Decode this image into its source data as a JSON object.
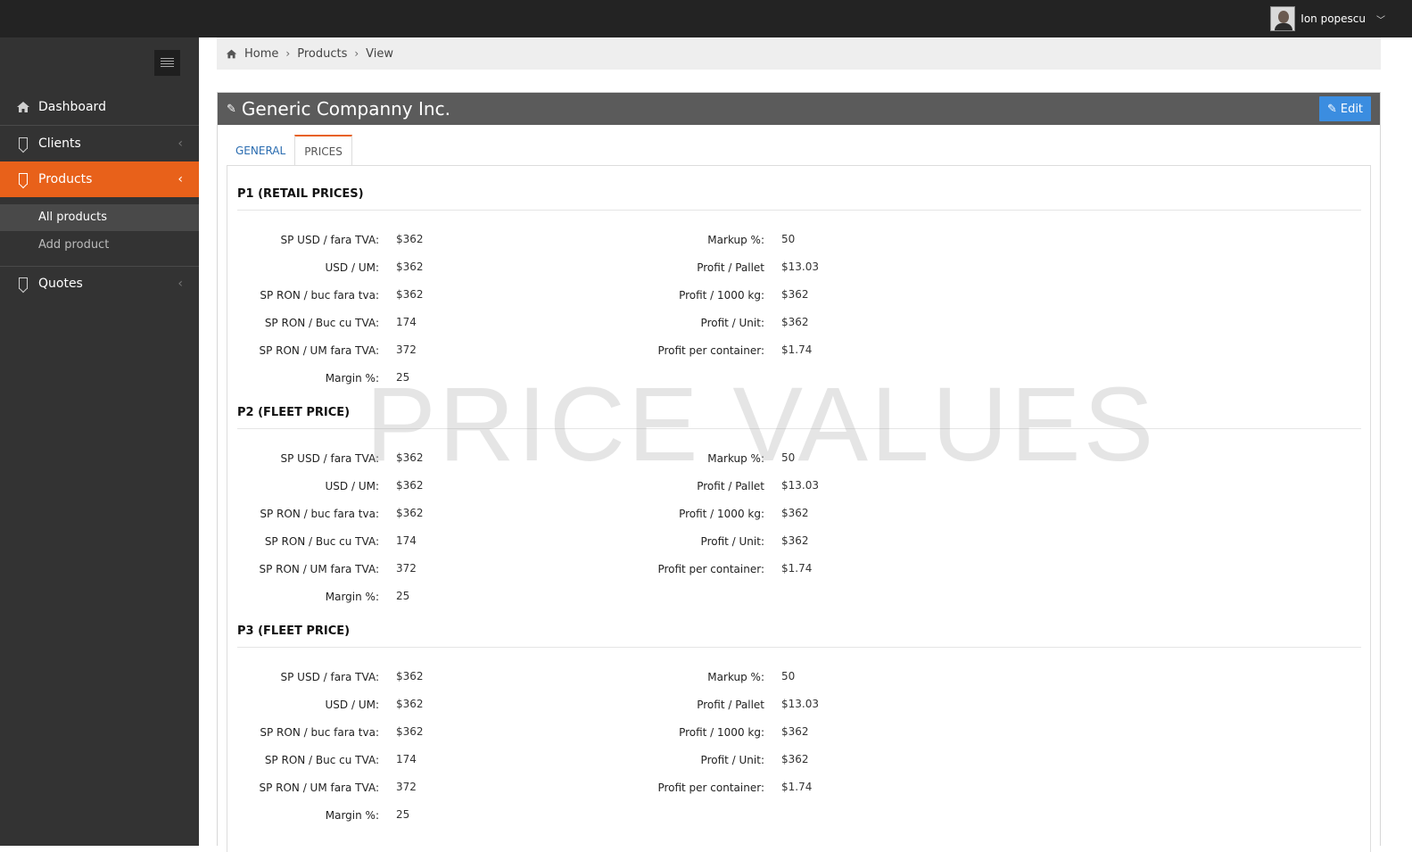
{
  "topbar": {
    "user_name": "Ion popescu",
    "caret": "﹀"
  },
  "sidebar": {
    "items": [
      {
        "label": "Dashboard",
        "chevron": ""
      },
      {
        "label": "Clients",
        "chevron": "‹"
      },
      {
        "label": "Products",
        "chevron": "‹"
      },
      {
        "label": "Quotes",
        "chevron": "‹"
      }
    ],
    "subitems": [
      {
        "label": "All products"
      },
      {
        "label": "Add product"
      }
    ]
  },
  "breadcrumb": {
    "home": "Home",
    "products": "Products",
    "view": "View",
    "sep": "›"
  },
  "panel": {
    "title": "Generic Companny Inc.",
    "edit_label": "Edit",
    "pencil": "✎"
  },
  "tabs": [
    {
      "label": "GENERAL"
    },
    {
      "label": "PRICES"
    }
  ],
  "sections": [
    {
      "title": "P1 (RETAIL PRICES)",
      "left": [
        {
          "label": "SP USD / fara TVA:",
          "value": "$362"
        },
        {
          "label": "USD / UM:",
          "value": "$362"
        },
        {
          "label": "SP RON / buc fara tva:",
          "value": "$362"
        },
        {
          "label": "SP RON / Buc cu TVA:",
          "value": "174"
        },
        {
          "label": "SP RON / UM fara TVA:",
          "value": "372"
        },
        {
          "label": "Margin %:",
          "value": "25"
        }
      ],
      "right": [
        {
          "label": "Markup %:",
          "value": "50"
        },
        {
          "label": "Profit / Pallet",
          "value": "$13.03"
        },
        {
          "label": "Profit / 1000 kg:",
          "value": "$362"
        },
        {
          "label": "Profit / Unit:",
          "value": "$362"
        },
        {
          "label": "Profit per container:",
          "value": "$1.74"
        }
      ]
    },
    {
      "title": "P2 (FLEET PRICE)",
      "left": [
        {
          "label": "SP USD / fara TVA:",
          "value": "$362"
        },
        {
          "label": "USD / UM:",
          "value": "$362"
        },
        {
          "label": "SP RON / buc fara tva:",
          "value": "$362"
        },
        {
          "label": "SP RON / Buc cu TVA:",
          "value": "174"
        },
        {
          "label": "SP RON / UM fara TVA:",
          "value": "372"
        },
        {
          "label": "Margin %:",
          "value": "25"
        }
      ],
      "right": [
        {
          "label": "Markup %:",
          "value": "50"
        },
        {
          "label": "Profit / Pallet",
          "value": "$13.03"
        },
        {
          "label": "Profit / 1000 kg:",
          "value": "$362"
        },
        {
          "label": "Profit / Unit:",
          "value": "$362"
        },
        {
          "label": "Profit per container:",
          "value": "$1.74"
        }
      ]
    },
    {
      "title": "P3 (FLEET PRICE)",
      "left": [
        {
          "label": "SP USD / fara TVA:",
          "value": "$362"
        },
        {
          "label": "USD / UM:",
          "value": "$362"
        },
        {
          "label": "SP RON / buc fara tva:",
          "value": "$362"
        },
        {
          "label": "SP RON / Buc cu TVA:",
          "value": "174"
        },
        {
          "label": "SP RON / UM fara TVA:",
          "value": "372"
        },
        {
          "label": "Margin %:",
          "value": "25"
        }
      ],
      "right": [
        {
          "label": "Markup %:",
          "value": "50"
        },
        {
          "label": "Profit / Pallet",
          "value": "$13.03"
        },
        {
          "label": "Profit / 1000 kg:",
          "value": "$362"
        },
        {
          "label": "Profit / Unit:",
          "value": "$362"
        },
        {
          "label": "Profit per container:",
          "value": "$1.74"
        }
      ]
    }
  ],
  "watermark": "PRICE VALUES",
  "colors": {
    "accent": "#e8611a",
    "primary_button": "#3b8de0",
    "sidebar_bg": "#333333",
    "topbar_bg": "#232323"
  },
  "icons": {
    "home": "home-icon",
    "bookmark": "bookmark-icon",
    "pencil": "pencil-icon",
    "menu": "menu-icon"
  }
}
